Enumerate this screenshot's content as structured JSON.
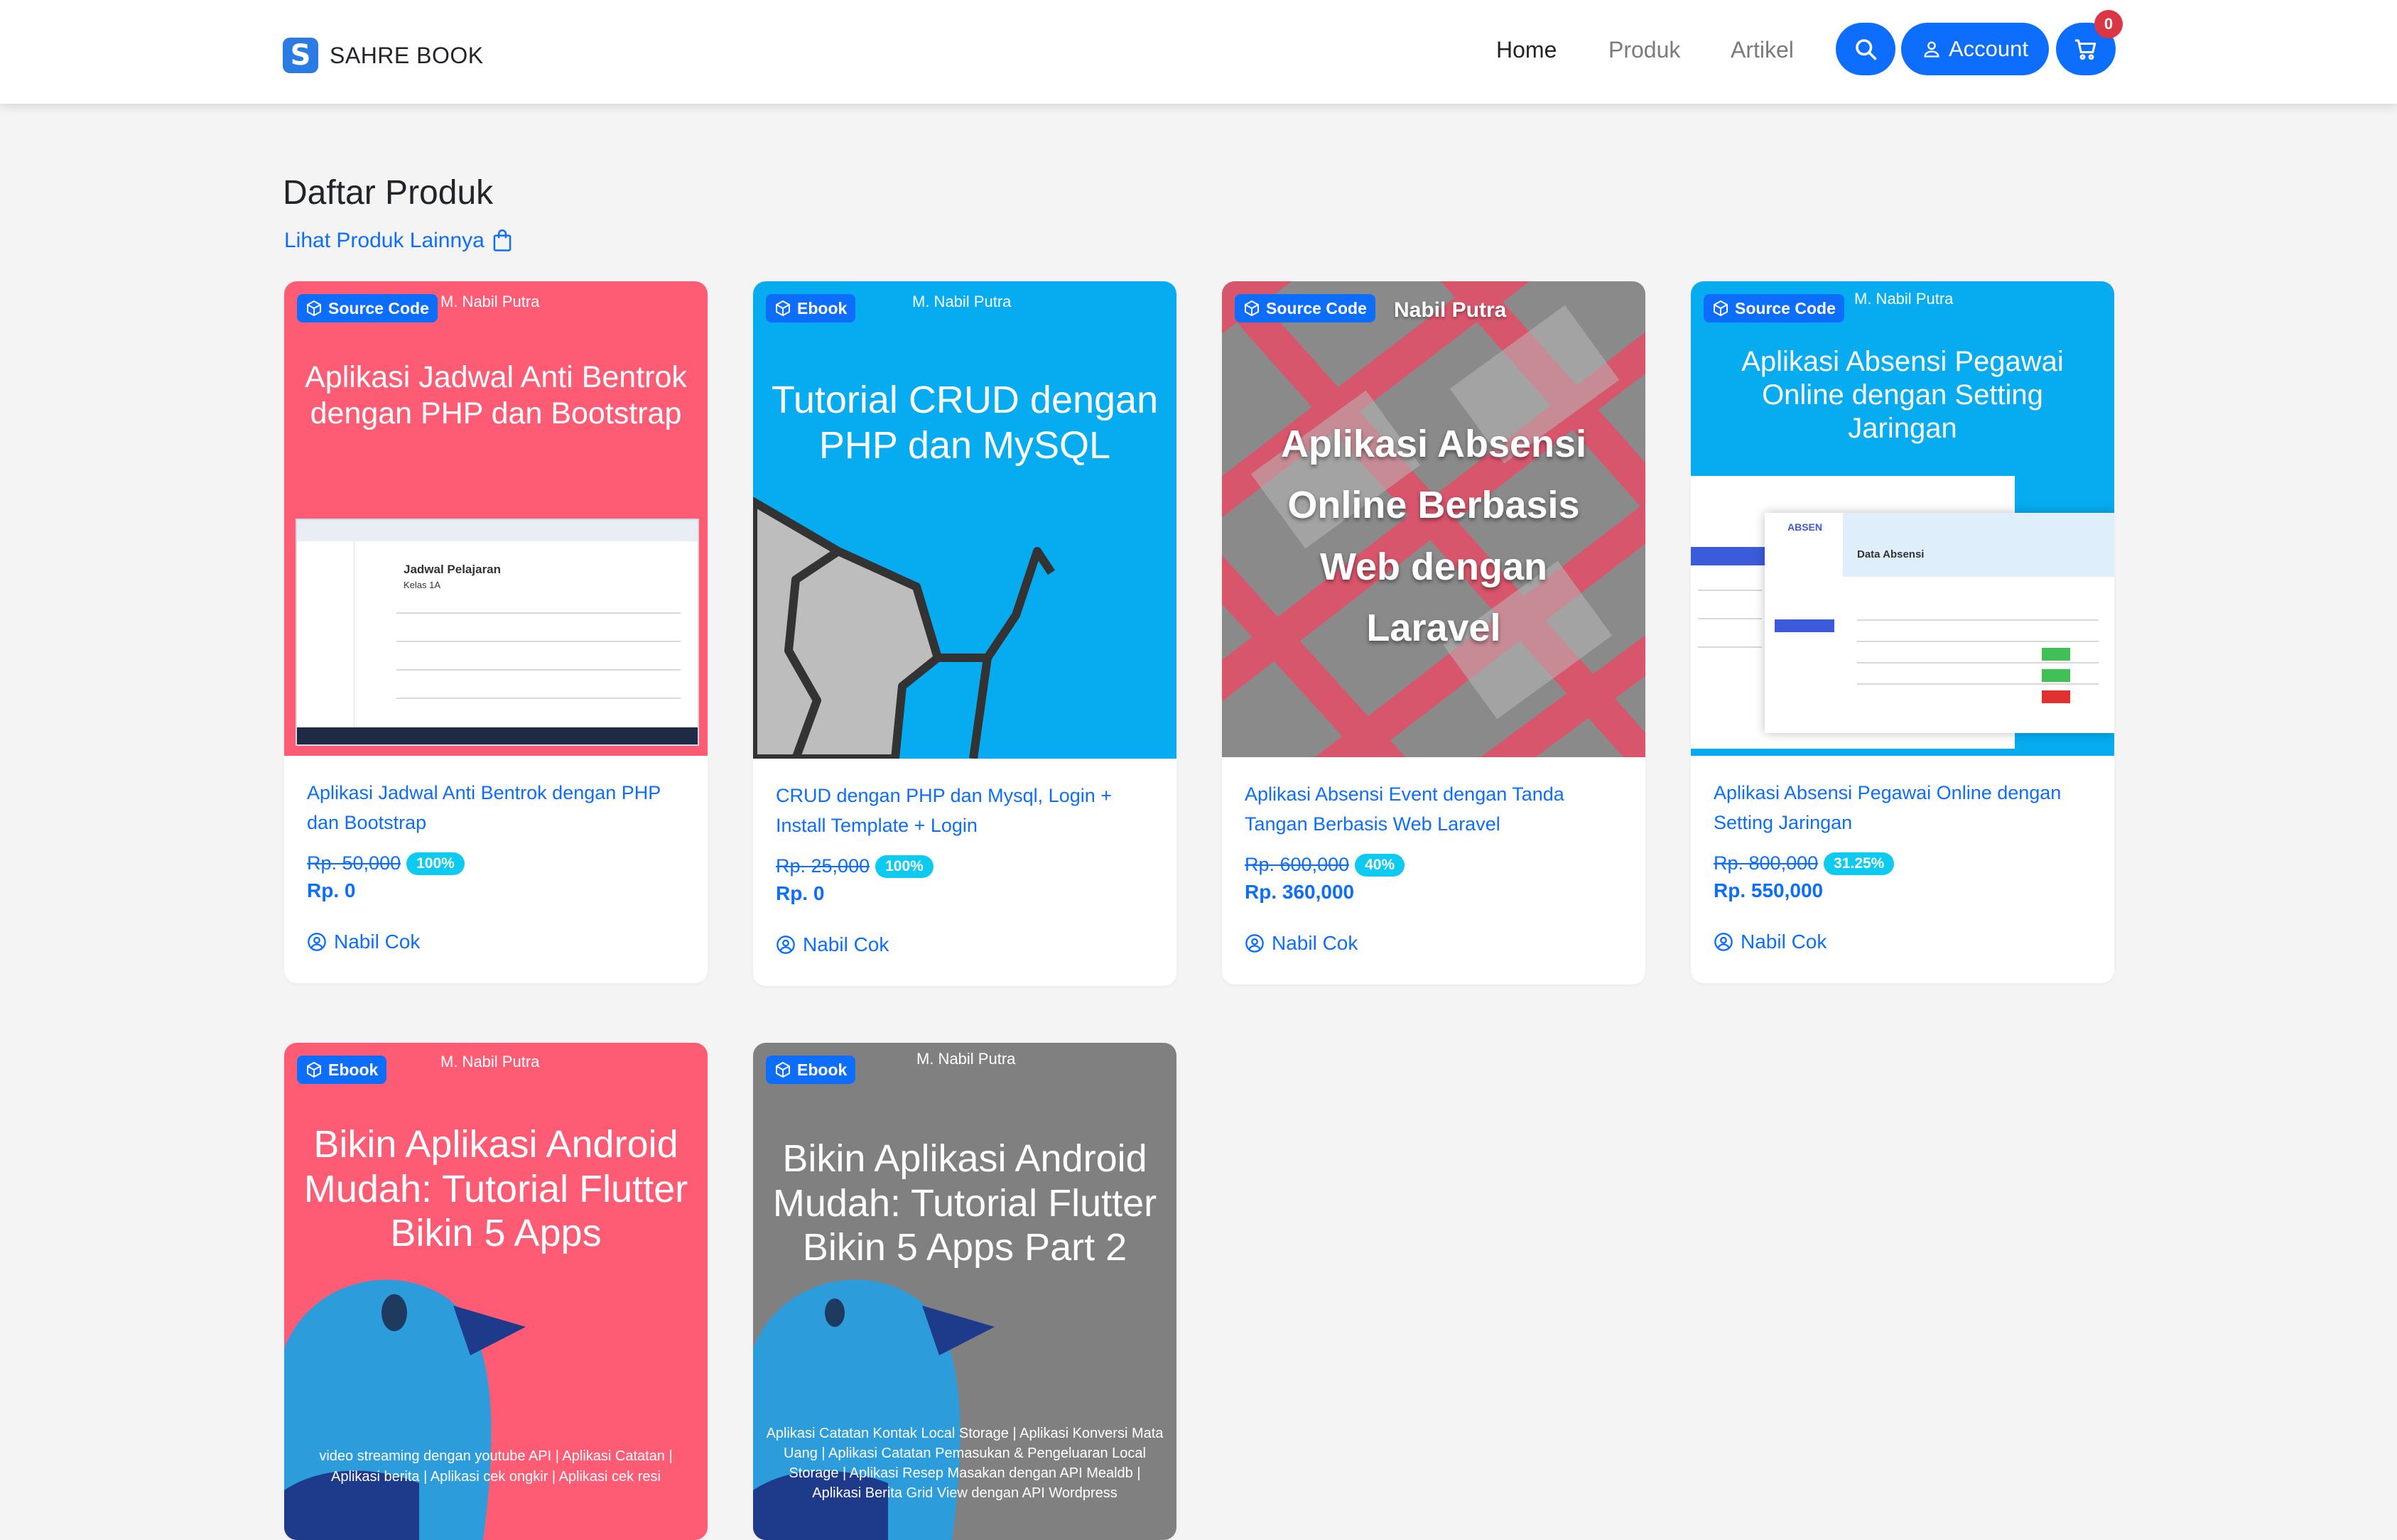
{
  "navbar": {
    "brand": "SAHRE BOOK",
    "links": [
      "Home",
      "Produk",
      "Artikel"
    ],
    "account_label": "Account",
    "cart_count": "0"
  },
  "page": {
    "title": "Daftar Produk",
    "more_link": "Lihat Produk Lainnya"
  },
  "products": [
    {
      "type": "Source Code",
      "cover_author": "M. Nabil Putra",
      "cover_title": "Aplikasi Jadwal Anti Bentrok dengan PHP dan Bootstrap",
      "cover_screen_title": "Jadwal Pelajaran",
      "cover_screen_subtitle": "Kelas 1A",
      "name": "Aplikasi Jadwal Anti Bentrok dengan PHP dan Bootstrap",
      "old_price": "Rp. 50,000",
      "discount": "100%",
      "price": "Rp. 0",
      "seller": "Nabil Cok"
    },
    {
      "type": "Ebook",
      "cover_author": "M. Nabil Putra",
      "cover_title": "Tutorial CRUD dengan PHP dan MySQL",
      "name": "CRUD dengan PHP dan Mysql, Login + Install Template + Login",
      "old_price": "Rp. 25,000",
      "discount": "100%",
      "price": "Rp. 0",
      "seller": "Nabil Cok"
    },
    {
      "type": "Source Code",
      "cover_author": "Nabil Putra",
      "cover_title": "Aplikasi Absensi Online Berbasis Web dengan Laravel",
      "name": "Aplikasi Absensi Event dengan Tanda Tangan Berbasis Web Laravel",
      "old_price": "Rp. 600,000",
      "discount": "40%",
      "price": "Rp. 360,000",
      "seller": "Nabil Cok"
    },
    {
      "type": "Source Code",
      "cover_author": "M. Nabil Putra",
      "cover_title": "Aplikasi Absensi Pegawai Online dengan Setting Jaringan",
      "cover_screen_title": "Data Absensi",
      "cover_screen_brand": "ABSEN",
      "name": "Aplikasi Absensi Pegawai Online dengan Setting Jaringan",
      "old_price": "Rp. 800,000",
      "discount": "31.25%",
      "price": "Rp. 550,000",
      "seller": "Nabil Cok"
    },
    {
      "type": "Ebook",
      "cover_author": "M. Nabil Putra",
      "cover_title": "Bikin Aplikasi Android Mudah: Tutorial Flutter Bikin 5 Apps",
      "cover_footer": "video streaming dengan youtube API | Aplikasi Catatan | Aplikasi berita | Aplikasi cek ongkir | Aplikasi cek resi"
    },
    {
      "type": "Ebook",
      "cover_author": "M. Nabil Putra",
      "cover_title": "Bikin Aplikasi Android Mudah: Tutorial Flutter Bikin 5 Apps Part 2",
      "cover_footer": "Aplikasi Catatan Kontak Local Storage | Aplikasi Konversi Mata Uang | Aplikasi Catatan Pemasukan & Pengeluaran Local Storage | Aplikasi Resep Masakan dengan API Mealdb | Aplikasi Berita Grid View dengan API Wordpress"
    }
  ],
  "colors": {
    "primary": "#0d6efd",
    "badge_discount": "#0dcaf0",
    "cover_pink": "#fd5c74",
    "cover_blue": "#06acef",
    "cover_gray": "#808080"
  }
}
